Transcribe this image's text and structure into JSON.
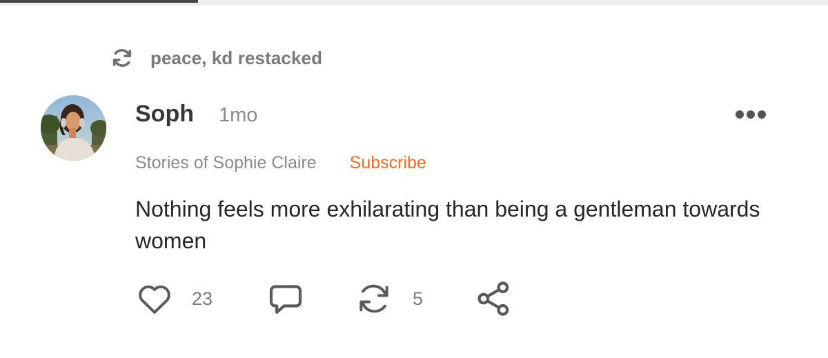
{
  "restack": {
    "label": "peace, kd restacked",
    "icon": "restack-icon"
  },
  "post": {
    "author": "Soph",
    "time": "1mo",
    "publication": "Stories of Sophie Claire",
    "subscribe_label": "Subscribe",
    "body": "Nothing feels more exhilarating than being a gentleman towards women",
    "menu_icon": "more-icon"
  },
  "actions": {
    "likes": "23",
    "restacks": "5",
    "icons": [
      "heart-icon",
      "comment-icon",
      "restack-icon",
      "share-icon"
    ]
  },
  "colors": {
    "accent": "#ff6719",
    "text": "#262626",
    "muted": "#8a8a8a",
    "icon": "#5a5a5a"
  }
}
